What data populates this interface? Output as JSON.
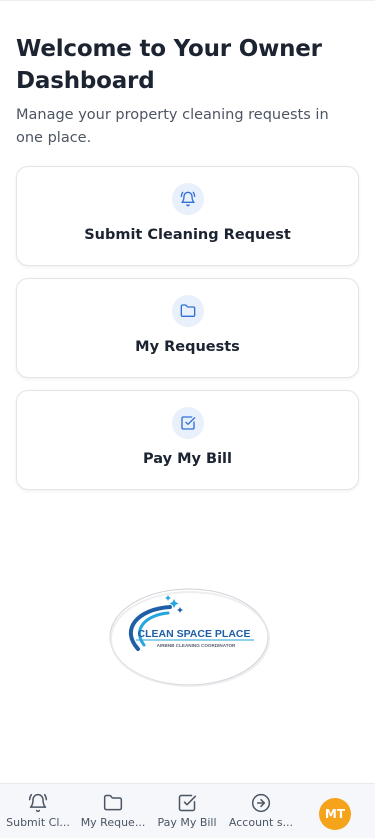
{
  "header": {
    "title": "Welcome to Your Owner Dashboard",
    "subtitle": "Manage your property cleaning requests in one place."
  },
  "cards": [
    {
      "label": "Submit Cleaning Request",
      "icon": "bell-icon"
    },
    {
      "label": "My Requests",
      "icon": "folder-icon"
    },
    {
      "label": "Pay My Bill",
      "icon": "checkbox-icon"
    }
  ],
  "logo": {
    "brand": "CLEAN SPACE PLACE",
    "tagline": "AIRBNB CLEANING COORDINATOR"
  },
  "bottom_nav": [
    {
      "label": "Submit Cl...",
      "icon": "bell-icon"
    },
    {
      "label": "My Reque...",
      "icon": "folder-icon"
    },
    {
      "label": "Pay My Bill",
      "icon": "checkbox-icon"
    },
    {
      "label": "Account s...",
      "icon": "sign-in-icon"
    }
  ],
  "avatar": {
    "initials": "MT"
  },
  "colors": {
    "accent": "#2f6fd6",
    "icon_bg": "#e8f0fc",
    "avatar_bg": "#f5a31a",
    "logo_blue": "#1f5fa8",
    "logo_cyan": "#22a6dd"
  }
}
